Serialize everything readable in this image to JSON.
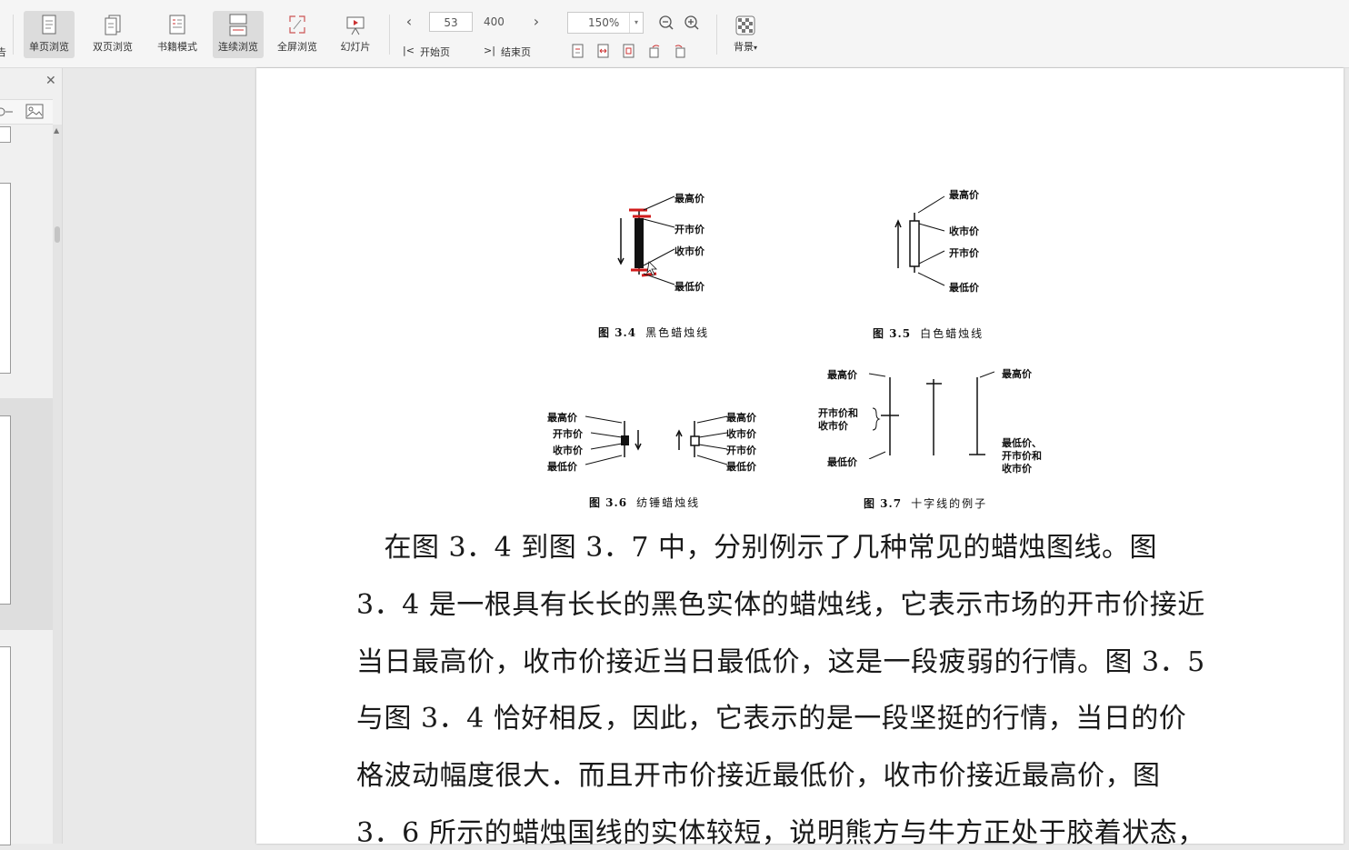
{
  "toolbar": {
    "view_buttons": [
      {
        "label": "单页浏览",
        "icon": "single-page-icon"
      },
      {
        "label": "双页浏览",
        "icon": "double-page-icon"
      },
      {
        "label": "书籍模式",
        "icon": "book-mode-icon"
      },
      {
        "label": "连续浏览",
        "icon": "continuous-icon"
      },
      {
        "label": "全屏浏览",
        "icon": "fullscreen-icon"
      },
      {
        "label": "幻灯片",
        "icon": "slideshow-icon"
      }
    ],
    "current_page": "53",
    "total_pages": "400",
    "first_page_label": "开始页",
    "last_page_label": "结束页",
    "zoom": "150%",
    "background_label": "背景",
    "left_edge_char": "告"
  },
  "document": {
    "fig34": {
      "caption_num": "图 3.4",
      "caption_text": "黑色蜡烛线",
      "labels": [
        "最高价",
        "开市价",
        "收市价",
        "最低价"
      ]
    },
    "fig35": {
      "caption_num": "图 3.5",
      "caption_text": "白色蜡烛线",
      "labels": [
        "最高价",
        "收市价",
        "开市价",
        "最低价"
      ]
    },
    "fig36": {
      "caption_num": "图 3.6",
      "caption_text": "纺锤蜡烛线",
      "left_labels": [
        "最高价",
        "开市价",
        "收市价",
        "最低价"
      ],
      "right_labels": [
        "最高价",
        "收市价",
        "开市价",
        "最低价"
      ]
    },
    "fig37": {
      "caption_num": "图 3.7",
      "caption_text": "十字线的例子",
      "top_left": "最高价",
      "mid_left_1": "开市价和",
      "mid_left_2": "收市价",
      "bottom_left": "最低价",
      "top_right": "最高价",
      "bottom_right_1": "最低价、",
      "bottom_right_2": "开市价和",
      "bottom_right_3": "收市价"
    },
    "paragraph": [
      "　在图 3．4 到图 3．7 中，分别例示了几种常见的蜡烛图线。图",
      "3．4 是一根具有长长的黑色实体的蜡烛线，它表示市场的开市价接近",
      "当日最高价，收市价接近当日最低价，这是一段疲弱的行情。图 3．5",
      "与图 3．4 恰好相反，因此，它表示的是一段坚挺的行情，当日的价",
      "格波动幅度很大．而且开市价接近最低价，收市价接近最高价，图",
      "3．6 所示的蜡烛国线的实体较短，说明熊方与牛方正处于胶着状态，"
    ]
  },
  "colors": {
    "annotation_red": "#d11a1a"
  }
}
